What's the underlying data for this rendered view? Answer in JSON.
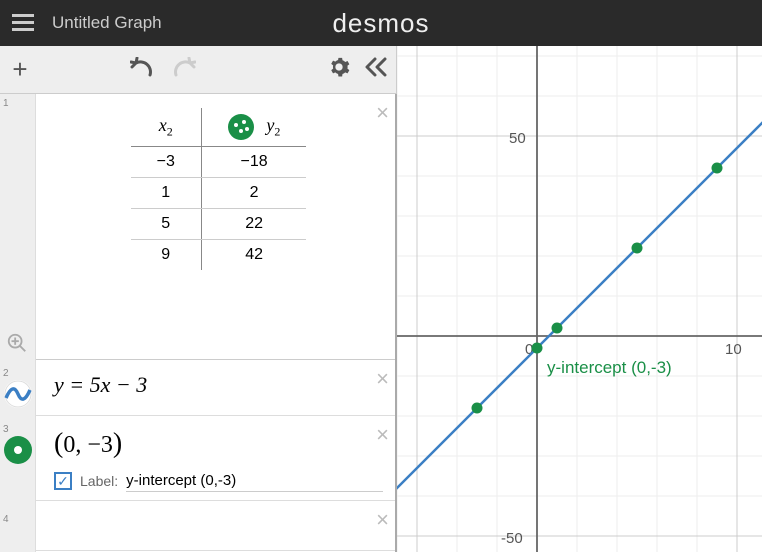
{
  "header": {
    "title": "Untitled Graph",
    "brand": "desmos"
  },
  "expressions": [
    {
      "type": "table",
      "header_x": "x",
      "header_x_sub": "2",
      "header_y": "y",
      "header_y_sub": "2",
      "rows": [
        {
          "x": "−3",
          "y": "−18"
        },
        {
          "x": "1",
          "y": "2"
        },
        {
          "x": "5",
          "y": "22"
        },
        {
          "x": "9",
          "y": "42"
        }
      ]
    },
    {
      "type": "expression",
      "latex": "y = 5x − 3"
    },
    {
      "type": "point",
      "latex": "(0, −3)",
      "label_checked": true,
      "label_prefix": "Label:",
      "label_text": "y-intercept (0,-3)"
    }
  ],
  "graph": {
    "point_label": "y-intercept (0,-3)",
    "x_tick_label_0": "0",
    "x_tick_label_10": "10",
    "y_tick_label_50": "50",
    "y_tick_label_n50": "-50"
  },
  "chart_data": {
    "type": "line",
    "equation": "y = 5x - 3",
    "x": [
      -3,
      1,
      5,
      9
    ],
    "y": [
      -18,
      2,
      22,
      42
    ],
    "labeled_point": {
      "x": 0,
      "y": -3,
      "label": "y-intercept (0,-3)"
    },
    "xlim": [
      -5,
      13
    ],
    "ylim": [
      -70,
      70
    ],
    "xlabel": "",
    "ylabel": "",
    "title": ""
  }
}
